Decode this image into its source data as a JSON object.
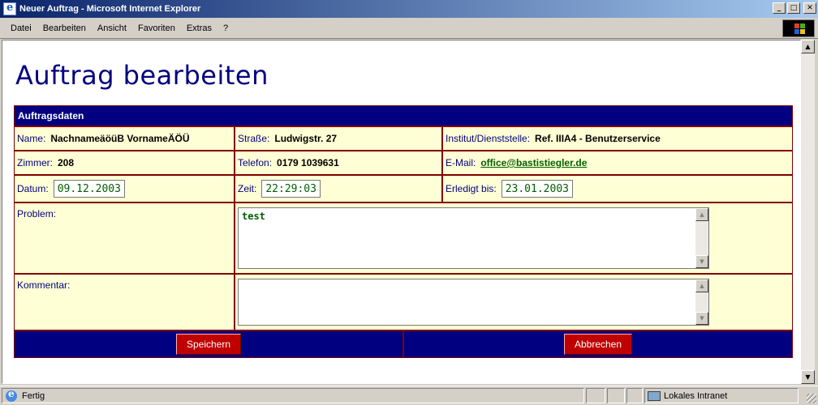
{
  "window": {
    "title": "Neuer Auftrag - Microsoft Internet Explorer",
    "buttons": {
      "minimize": "_",
      "maximize": "□",
      "close": "✕"
    }
  },
  "menu": [
    {
      "label": "Datei"
    },
    {
      "label": "Bearbeiten"
    },
    {
      "label": "Ansicht"
    },
    {
      "label": "Favoriten"
    },
    {
      "label": "Extras"
    },
    {
      "label": "?"
    }
  ],
  "page": {
    "title": "Auftrag bearbeiten",
    "section_header": "Auftragsdaten",
    "fields": {
      "name": {
        "label": "Name:",
        "value": "NachnameäöüB VornameÄÖÜ"
      },
      "strasse": {
        "label": "Straße:",
        "value": "Ludwigstr. 27"
      },
      "institut": {
        "label": "Institut/Dienststelle:",
        "value": "Ref. IIIA4 - Benutzerservice"
      },
      "zimmer": {
        "label": "Zimmer:",
        "value": "208"
      },
      "telefon": {
        "label": "Telefon:",
        "value": "0179 1039631"
      },
      "email": {
        "label": "E-Mail:",
        "value": "office@bastistiegler.de"
      },
      "datum": {
        "label": "Datum:",
        "value": "09.12.2003"
      },
      "zeit": {
        "label": "Zeit:",
        "value": "22:29:03"
      },
      "erledigt": {
        "label": "Erledigt bis:",
        "value": "23.01.2003"
      },
      "problem": {
        "label": "Problem:",
        "value": "test"
      },
      "kommentar": {
        "label": "Kommentar:",
        "value": ""
      }
    },
    "buttons": {
      "save": "Speichern",
      "cancel": "Abbrechen"
    }
  },
  "statusbar": {
    "text": "Fertig",
    "zone": "Lokales Intranet"
  },
  "colors": {
    "header_bg": "#000080",
    "cell_bg": "#ffffd5",
    "border": "#800000",
    "button_bg": "#c00000",
    "field_text": "#006000"
  }
}
